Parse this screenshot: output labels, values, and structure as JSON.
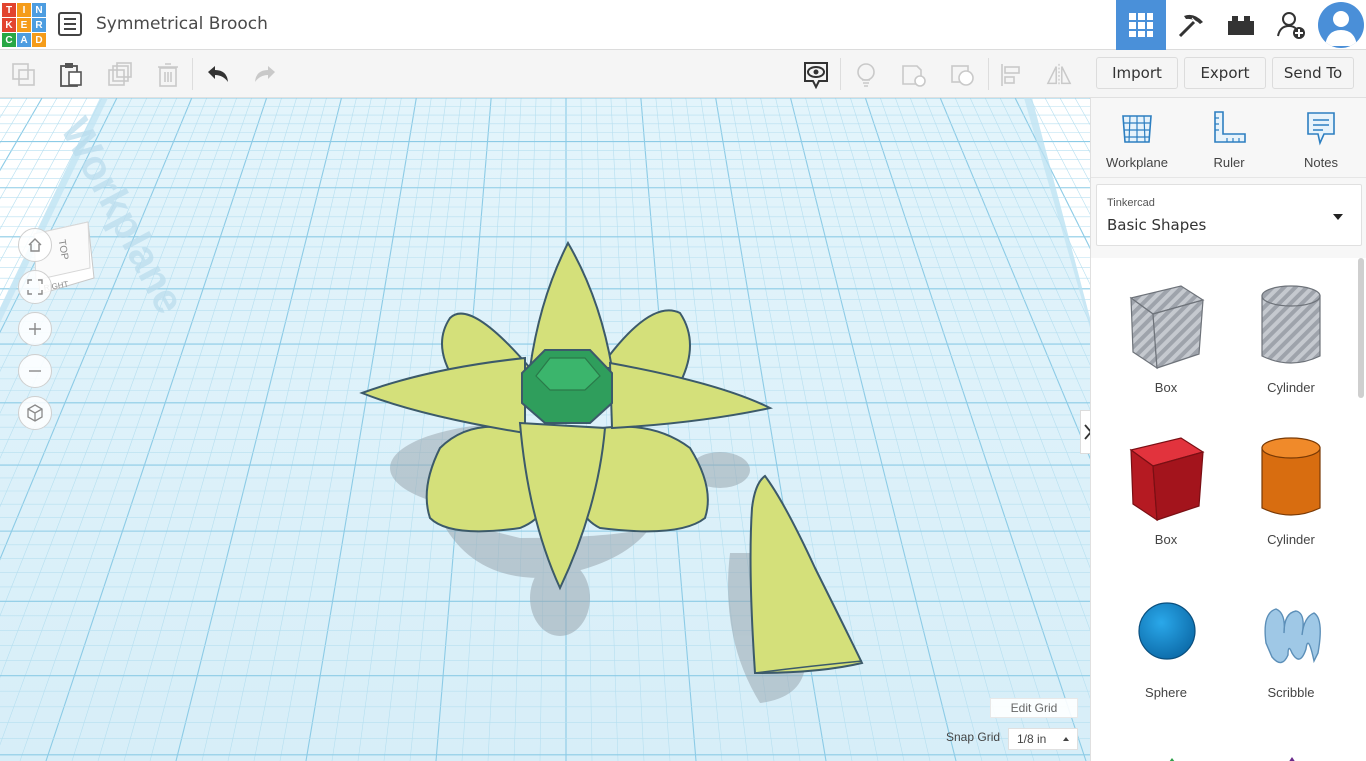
{
  "app": {
    "logo_letters": [
      "T",
      "I",
      "N",
      "K",
      "E",
      "R",
      "C",
      "A",
      "D"
    ],
    "logo_colors": [
      "#e2442f",
      "#f59c1a",
      "#4d9de0",
      "#e2442f",
      "#f59c1a",
      "#4d9de0",
      "#28a745",
      "#4d9de0",
      "#f59c1a"
    ],
    "title": "Symmetrical Brooch",
    "menu_icon": "list-icon",
    "header_icons": [
      "3d-design-grid-icon",
      "codeblocks-pickaxe-icon",
      "bricks-lego-icon",
      "add-user-icon",
      "avatar-icon"
    ],
    "accent_color": "#4a90d9"
  },
  "toolbar": {
    "icons": [
      "copy-icon",
      "paste-icon",
      "duplicate-icon",
      "delete-icon",
      "undo-icon",
      "redo-icon",
      "notes-visibility-icon",
      "lightbulb-icon",
      "group-icon",
      "ungroup-icon",
      "align-icon",
      "mirror-icon"
    ],
    "import_label": "Import",
    "export_label": "Export",
    "sendto_label": "Send To"
  },
  "viewcube": {
    "top_label": "TOP",
    "right_label": "RIGHT"
  },
  "nav": {
    "icons": [
      "home-icon",
      "fit-view-icon",
      "zoom-in-icon",
      "zoom-out-icon",
      "perspective-cube-icon"
    ]
  },
  "workplane": {
    "watermark": "Workplane"
  },
  "grid": {
    "edit_label": "Edit Grid",
    "snap_label": "Snap Grid",
    "snap_value": "1/8 in"
  },
  "panel": {
    "tools": [
      {
        "label": "Workplane",
        "icon": "workplane-icon"
      },
      {
        "label": "Ruler",
        "icon": "ruler-icon"
      },
      {
        "label": "Notes",
        "icon": "notes-icon"
      }
    ],
    "library_category": "Tinkercad",
    "library_name": "Basic Shapes",
    "shapes": [
      {
        "label": "Box",
        "kind": "box-hole",
        "color": "#b8bcc4"
      },
      {
        "label": "Cylinder",
        "kind": "cylinder-hole",
        "color": "#b8bcc4"
      },
      {
        "label": "Box",
        "kind": "box-solid",
        "color": "#c8202a"
      },
      {
        "label": "Cylinder",
        "kind": "cylinder-solid",
        "color": "#e07a1a"
      },
      {
        "label": "Sphere",
        "kind": "sphere",
        "color": "#1a8fd0"
      },
      {
        "label": "Scribble",
        "kind": "scribble",
        "color": "#8fbfe0"
      }
    ]
  },
  "scene": {
    "flower_color": "#d4e07a",
    "gem_color": "#2f9e5c",
    "cone_color": "#d4e07a"
  }
}
